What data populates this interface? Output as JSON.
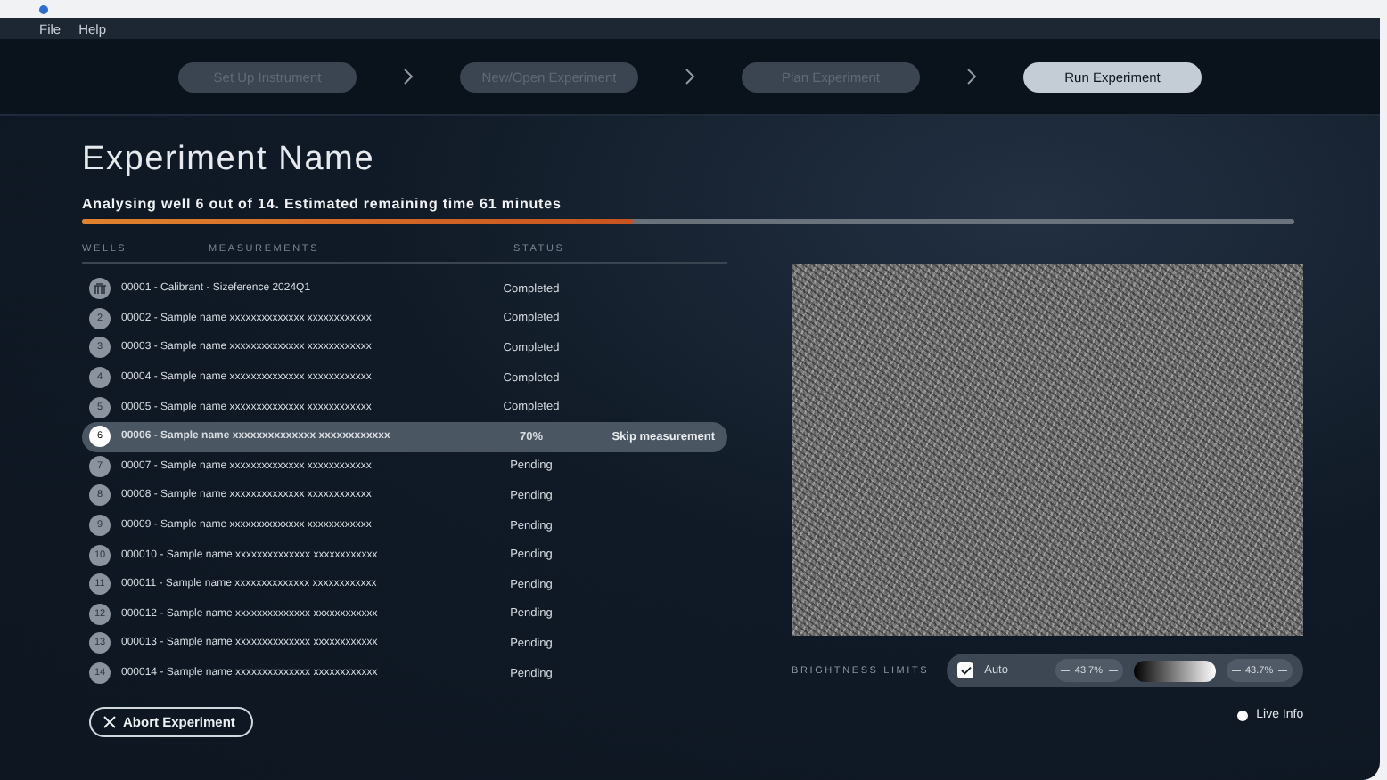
{
  "menu": [
    "File",
    "Help"
  ],
  "steps": [
    {
      "label": "Set Up Instrument",
      "selected": false
    },
    {
      "label": "New/Open Experiment",
      "selected": false
    },
    {
      "label": "Plan Experiment",
      "selected": false
    },
    {
      "label": "Run Experiment",
      "selected": true
    }
  ],
  "title": "Experiment Name",
  "progress": {
    "text": "Analysing well 6 out of 14. Estimated remaining time 61 minutes",
    "level": 0.455
  },
  "table": {
    "columns": [
      "WELLS",
      "MEASUREMENTS",
      "STATUS"
    ],
    "rows": [
      {
        "kind": "calibrant",
        "well": "",
        "name": "00001 - Calibrant - Sizeference 2024Q1",
        "status": "Completed",
        "selected": false
      },
      {
        "kind": "sample",
        "well": "2",
        "name": "00002 - Sample name xxxxxxxxxxxxxx  xxxxxxxxxxxx",
        "status": "Completed",
        "selected": false
      },
      {
        "kind": "sample",
        "well": "3",
        "name": "00003 - Sample name xxxxxxxxxxxxxx  xxxxxxxxxxxx",
        "status": "Completed",
        "selected": false
      },
      {
        "kind": "sample",
        "well": "4",
        "name": "00004 - Sample name xxxxxxxxxxxxxx  xxxxxxxxxxxx",
        "status": "Completed",
        "selected": false
      },
      {
        "kind": "sample",
        "well": "5",
        "name": "00005 - Sample name xxxxxxxxxxxxxx  xxxxxxxxxxxx",
        "status": "Completed",
        "selected": false
      },
      {
        "kind": "sample",
        "well": "6",
        "name": "00006 - Sample name xxxxxxxxxxxxxx  xxxxxxxxxxxx",
        "status": "70%",
        "action": "Skip measurement",
        "selected": true
      },
      {
        "kind": "sample",
        "well": "7",
        "name": "00007 - Sample name xxxxxxxxxxxxxx  xxxxxxxxxxxx",
        "status": "Pending",
        "selected": false
      },
      {
        "kind": "sample",
        "well": "8",
        "name": "00008 - Sample name xxxxxxxxxxxxxx  xxxxxxxxxxxx",
        "status": "Pending",
        "selected": false
      },
      {
        "kind": "sample",
        "well": "9",
        "name": "00009 - Sample name xxxxxxxxxxxxxx  xxxxxxxxxxxx",
        "status": "Pending",
        "selected": false
      },
      {
        "kind": "sample",
        "well": "10",
        "name": "000010 - Sample name xxxxxxxxxxxxxx  xxxxxxxxxxxx",
        "status": "Pending",
        "selected": false
      },
      {
        "kind": "sample",
        "well": "11",
        "name": "000011 - Sample name xxxxxxxxxxxxxx  xxxxxxxxxxxx",
        "status": "Pending",
        "selected": false
      },
      {
        "kind": "sample",
        "well": "12",
        "name": "000012 - Sample name xxxxxxxxxxxxxx  xxxxxxxxxxxx",
        "status": "Pending",
        "selected": false
      },
      {
        "kind": "sample",
        "well": "13",
        "name": "000013 - Sample name xxxxxxxxxxxxxx  xxxxxxxxxxxx",
        "status": "Pending",
        "selected": false
      },
      {
        "kind": "sample",
        "well": "14",
        "name": "000014 - Sample name xxxxxxxxxxxxxx  xxxxxxxxxxxx",
        "status": "Pending",
        "selected": false
      }
    ]
  },
  "abort_button": "Abort Experiment",
  "brightness": {
    "label": "BRIGHTNESS LIMITS",
    "auto": {
      "label": "Auto",
      "checked": true
    },
    "low": "43.7%",
    "high": "43.7%"
  },
  "live_info": "Live Info"
}
